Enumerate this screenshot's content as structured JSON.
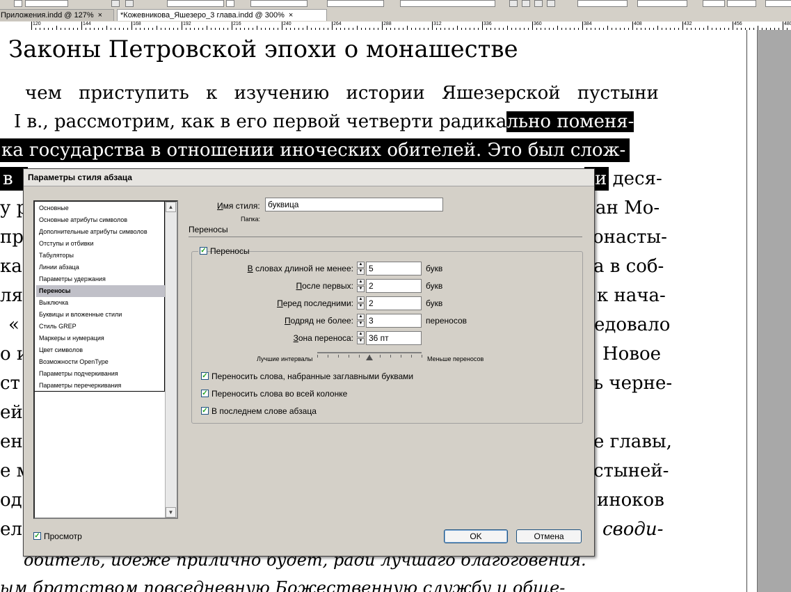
{
  "tabs": [
    {
      "label": "Приложения.indd @ 127%",
      "close": "×"
    },
    {
      "label": "*Кожевникова_Яшезеро_3 глава.indd @ 300%",
      "close": "×"
    }
  ],
  "ruler": {
    "ticks": [
      "120",
      "144",
      "168",
      "192",
      "216",
      "240",
      "264",
      "288",
      "312",
      "336",
      "360",
      "384",
      "408",
      "432",
      "456",
      "480"
    ]
  },
  "document": {
    "heading": "Законы Петровской эпохи о монашестве",
    "lines": [
      "чем приступить к изучению истории Яшезерской пустыни",
      "I в., рассмотрим, как в его первой четверти радикально поменя-",
      "ка государства в отношении иноческих обителей. Это был слож-",
      "в"
    ],
    "right_fragments": [
      "и деся-",
      "ан Мо-",
      "онасты-",
      "а в соб-",
      "к нача-",
      "едовало",
      "Новое",
      "ь черне-",
      "е главы,",
      "стыней-",
      "иноков",
      "своди-"
    ],
    "left_fragments": [
      "у р",
      "пр",
      "ка",
      "ля",
      "«",
      "о и",
      "ст",
      "ей",
      "ен",
      "е м",
      "од",
      "ел"
    ],
    "bottom_line_1": "обитель, идеже прилично будет, ради лучшаго благоговения.",
    "bottom_line_2": "ым братством повседневную Божественную службу и обще-"
  },
  "dialog": {
    "title": "Параметры стиля абзаца",
    "categories": [
      "Основные",
      "Основные атрибуты символов",
      "Дополнительные атрибуты символов",
      "Отступы и отбивки",
      "Табуляторы",
      "Линии абзаца",
      "Параметры удержания",
      "Переносы",
      "Выключка",
      "Буквицы и вложенные стили",
      "Стиль GREP",
      "Маркеры и нумерация",
      "Цвет символов",
      "Возможности OpenType",
      "Параметры подчеркивания",
      "Параметры перечеркивания"
    ],
    "selected_category": "Переносы",
    "style_name_label": "Имя стиля:",
    "style_name_value": "буквица",
    "folder_label": "Папка:",
    "section_title": "Переносы",
    "hyphenation_checkbox": "Переносы",
    "fields": [
      {
        "label": "В словах длиной не менее:",
        "value": "5",
        "unit": "букв"
      },
      {
        "label": "После первых:",
        "value": "2",
        "unit": "букв"
      },
      {
        "label": "Перед последними:",
        "value": "2",
        "unit": "букв"
      },
      {
        "label": "Подряд не более:",
        "value": "3",
        "unit": "переносов"
      },
      {
        "label": "Зона переноса:",
        "value": "36 пт",
        "unit": ""
      }
    ],
    "slider_left_label": "Лучшие интервалы",
    "slider_right_label": "Меньше переносов",
    "slider_value": 0.5,
    "options": [
      "Переносить слова, набранные заглавными буквами",
      "Переносить слова во всей колонке",
      "В последнем слове абзаца"
    ],
    "preview_label": "Просмотр",
    "ok_label": "OK",
    "cancel_label": "Отмена",
    "check_mark": "✓",
    "scroll_up": "▲",
    "scroll_down": "▼"
  }
}
